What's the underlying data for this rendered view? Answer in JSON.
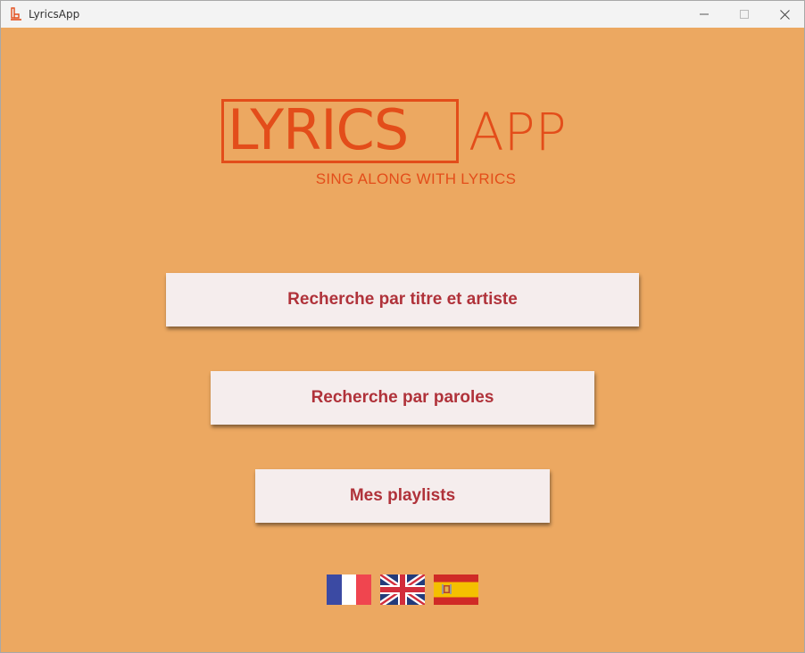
{
  "window": {
    "title": "LyricsApp",
    "app_icon": "lyrics-app-icon",
    "controls": {
      "minimize_icon": "minimize-icon",
      "maximize_icon": "maximize-icon",
      "close_icon": "close-icon"
    }
  },
  "logo": {
    "main": "LYRICS",
    "suffix": "APP",
    "tagline": "SING ALONG WITH LYRICS",
    "color": "#e34d1a"
  },
  "menu": {
    "search_title_artist": "Recherche par titre et artiste",
    "search_lyrics": "Recherche par paroles",
    "my_playlists": "Mes playlists"
  },
  "languages": [
    {
      "code": "fr",
      "icon": "france-flag-icon"
    },
    {
      "code": "en",
      "icon": "uk-flag-icon"
    },
    {
      "code": "es",
      "icon": "spain-flag-icon"
    }
  ],
  "colors": {
    "background": "#eca861",
    "button_bg": "#f5eded",
    "button_text": "#b0323a",
    "accent": "#e34d1a"
  }
}
